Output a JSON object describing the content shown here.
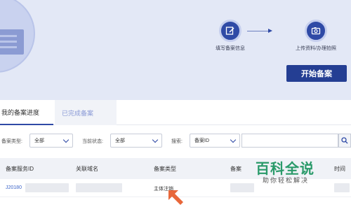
{
  "hero": {
    "steps": [
      {
        "label": "填写备案信息",
        "icon": "edit-icon"
      },
      {
        "label": "上传资料/办理拍照",
        "icon": "camera-icon"
      }
    ],
    "start_button": "开始备案"
  },
  "tabs": [
    {
      "label": "我的备案进度",
      "active": true
    },
    {
      "label": "已完成备案",
      "active": false
    }
  ],
  "filters": {
    "type_label": "备案类型:",
    "type_value": "全部",
    "status_label": "当前状态:",
    "status_value": "全部",
    "search_label": "搜索:",
    "search_field": "备案ID",
    "search_placeholder": ""
  },
  "table": {
    "headers": [
      "备案服务ID",
      "关联域名",
      "备案类型",
      "备案",
      "时间"
    ],
    "rows": [
      {
        "id": "J20180",
        "domain": "",
        "type": "主体注销"
      }
    ]
  },
  "watermark": {
    "title": "百科全说",
    "subtitle": "助你轻松解决"
  },
  "colors": {
    "brand": "#243e93",
    "hero_bg": "#e3e8f6",
    "link": "#3a63c8",
    "watermark": "#2a9a6a",
    "pointer": "#e8673a"
  }
}
